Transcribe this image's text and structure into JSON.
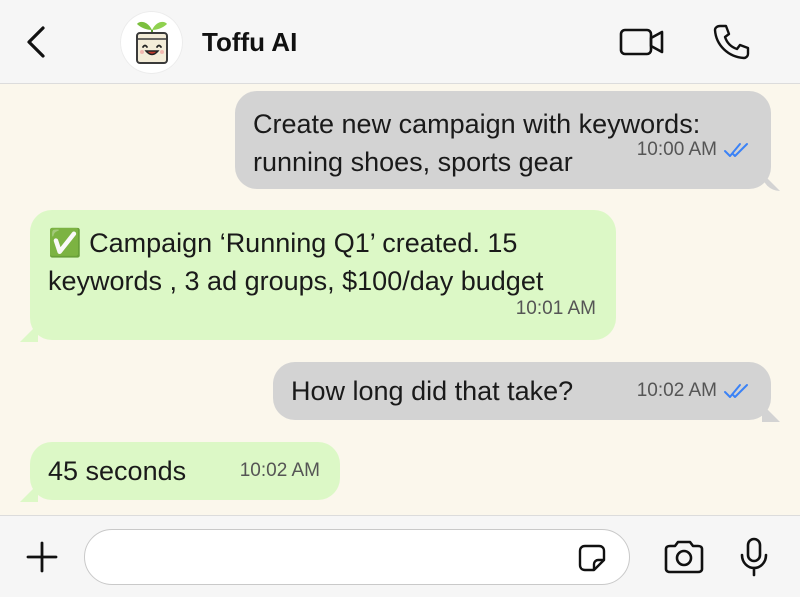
{
  "header": {
    "contact_name": "Toffu AI",
    "avatar_icon": "tofu-mascot-icon",
    "back_icon": "chevron-left-icon",
    "video_icon": "video-camera-icon",
    "call_icon": "phone-icon"
  },
  "messages": [
    {
      "direction": "outgoing",
      "lines": [
        "Create new campaign with keywords:",
        "running shoes, sports gear"
      ],
      "time": "10:00 AM",
      "status": "read"
    },
    {
      "direction": "incoming",
      "lines": [
        "✅ Campaign ‘Running Q1’ created. 15",
        "keywords , 3 ad groups, $100/day budget"
      ],
      "time": "10:01 AM"
    },
    {
      "direction": "outgoing",
      "lines": [
        "How long did that take?"
      ],
      "time": "10:02 AM",
      "status": "read"
    },
    {
      "direction": "incoming",
      "lines": [
        "45 seconds"
      ],
      "time": "10:02 AM"
    }
  ],
  "composer": {
    "value": "",
    "placeholder": "",
    "plus_icon": "plus-icon",
    "sticker_icon": "sticker-icon",
    "camera_icon": "camera-icon",
    "mic_icon": "microphone-icon"
  },
  "colors": {
    "header_bg": "#f6f6f6",
    "chat_bg": "#fbf7ec",
    "outgoing_bubble": "#d3d3d3",
    "incoming_bubble": "#dcf8c6",
    "read_ticks": "#3b82f6"
  }
}
